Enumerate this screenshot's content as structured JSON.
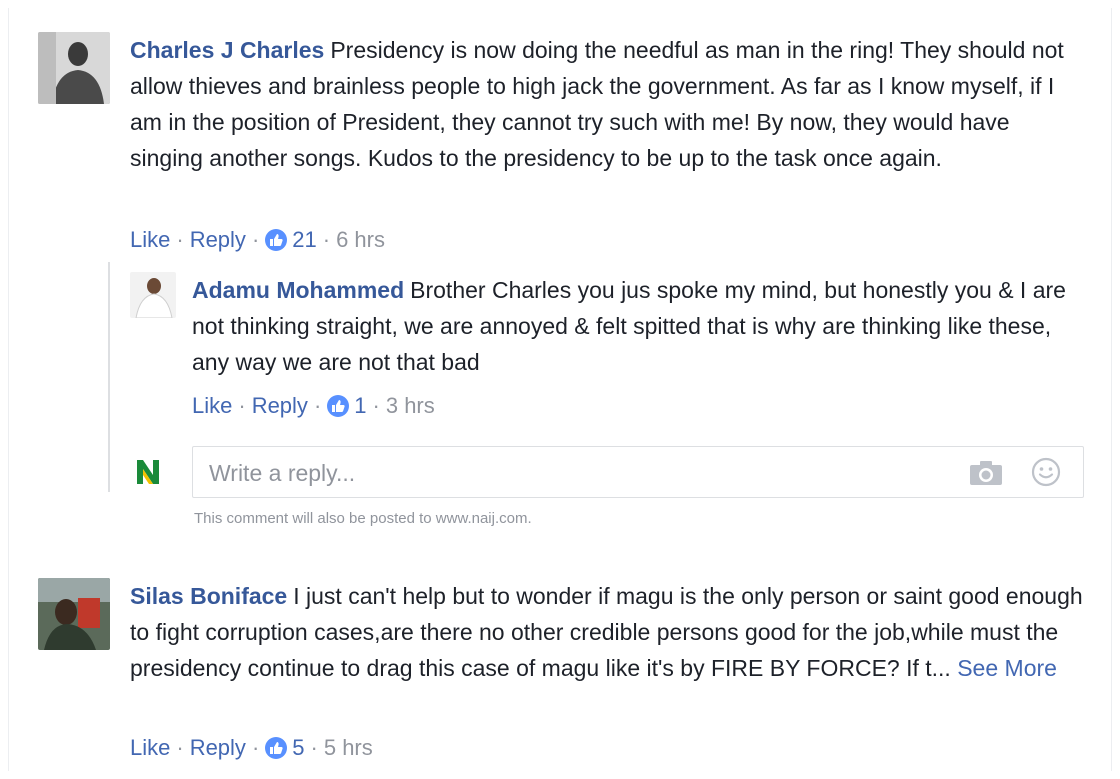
{
  "comments": [
    {
      "author": "Charles J Charles",
      "text": "Presidency is now doing the needful as man in the ring! They should not allow thieves and brainless people to high jack the government. As far as I know myself, if I am in the position of President, they cannot try such with me! By now, they would have singing another songs. Kudos to the presidency to be up to the task once again.",
      "like_label": "Like",
      "reply_label": "Reply",
      "likes": "21",
      "time": "6 hrs",
      "replies": [
        {
          "author": "Adamu Mohammed",
          "text": "Brother Charles you jus spoke my mind, but honestly you & I are not thinking straight, we are annoyed & felt spitted that is why are thinking like these, any way we are not that bad",
          "like_label": "Like",
          "reply_label": "Reply",
          "likes": "1",
          "time": "3 hrs"
        }
      ],
      "reply_box": {
        "placeholder": "Write a reply...",
        "avatar_letter": "N",
        "notice": "This comment will also be posted to www.naij.com."
      }
    },
    {
      "author": "Silas Boniface",
      "text": "I just can't help but to wonder if magu is the only person or saint good enough to fight corruption cases,are there no other credible persons good for the job,while must the presidency continue to drag this case of magu like it's by FIRE BY FORCE? If t...",
      "see_more": "See More",
      "like_label": "Like",
      "reply_label": "Reply",
      "likes": "5",
      "time": "5 hrs"
    }
  ],
  "icons": {
    "like": "thumbs-up-icon",
    "camera": "camera-icon",
    "emoji": "smiley-icon"
  },
  "colors": {
    "author": "#365899",
    "link": "#4267b2",
    "meta": "#90949c",
    "like_badge": "#5890ff",
    "naij_green": "#1a8a3a"
  }
}
